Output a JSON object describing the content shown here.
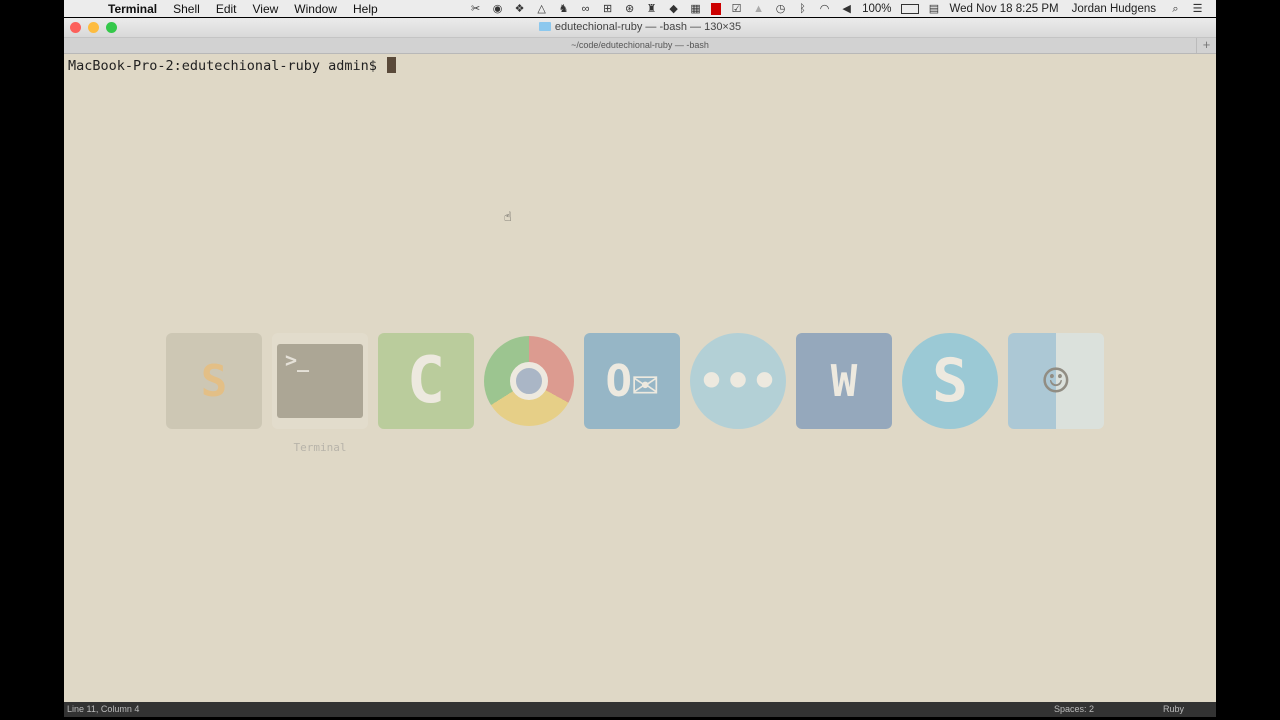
{
  "menubar": {
    "app": "Terminal",
    "items": [
      "Shell",
      "Edit",
      "View",
      "Window",
      "Help"
    ],
    "status_icons": [
      "scissors-icon",
      "camera-icon",
      "dropbox-icon",
      "drive-icon",
      "evernote-icon",
      "link-icon",
      "network-icon",
      "creative-cloud-icon",
      "lantern-icon",
      "elephant-icon",
      "grid-icon",
      "film-icon",
      "check-icon",
      "bell-icon",
      "time-machine-icon",
      "bluetooth-icon",
      "wifi-icon",
      "volume-icon"
    ],
    "battery": "100%",
    "datetime": "Wed Nov 18  8:25 PM",
    "user": "Jordan Hudgens"
  },
  "window": {
    "title": "edutechional-ruby — -bash — 130×35",
    "tab": "~/code/edutechional-ruby — -bash",
    "prompt": "MacBook-Pro-2:edutechional-ruby admin$ "
  },
  "switcher": {
    "selected_label": "Terminal",
    "apps": [
      {
        "name": "sublime",
        "glyph": "S",
        "color": "#b9b4a0"
      },
      {
        "name": "terminal",
        "glyph": ">_",
        "color": "#6f6a5c"
      },
      {
        "name": "camtasia",
        "glyph": "C",
        "color": "#8fbf6a"
      },
      {
        "name": "chrome",
        "glyph": "",
        "color": "#d9a0a0"
      },
      {
        "name": "outlook",
        "glyph": "O",
        "color": "#3f8fc8"
      },
      {
        "name": "messages",
        "glyph": "…",
        "color": "#7fc7ea"
      },
      {
        "name": "word",
        "glyph": "W",
        "color": "#3d6fb0"
      },
      {
        "name": "skype",
        "glyph": "S",
        "color": "#4ab8e8"
      },
      {
        "name": "finder",
        "glyph": "☺",
        "color": "#9fd0ee"
      }
    ]
  },
  "statusbar": {
    "position": "Line 11, Column 4",
    "spaces": "Spaces: 2",
    "syntax": "Ruby"
  }
}
